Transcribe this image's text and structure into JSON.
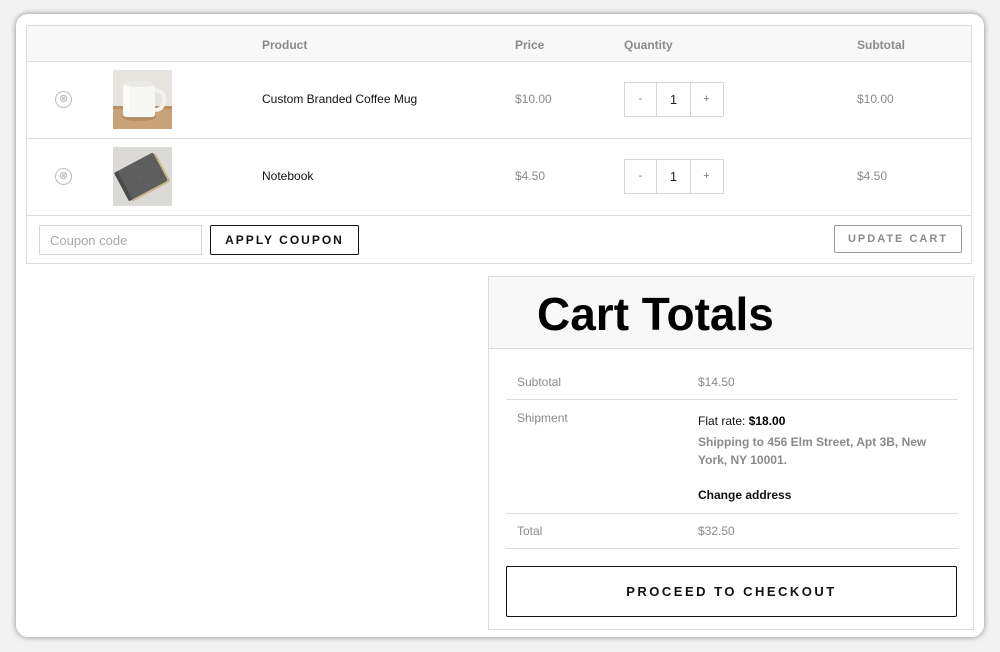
{
  "cart": {
    "headers": {
      "product": "Product",
      "price": "Price",
      "quantity": "Quantity",
      "subtotal": "Subtotal"
    },
    "items": [
      {
        "name": "Custom Branded Coffee Mug",
        "price": "$10.00",
        "quantity": "1",
        "subtotal": "$10.00",
        "image_icon": "coffee-mug-image"
      },
      {
        "name": "Notebook",
        "price": "$4.50",
        "quantity": "1",
        "subtotal": "$4.50",
        "image_icon": "notebook-image"
      }
    ],
    "qty_minus": "-",
    "qty_plus": "+",
    "remove_icon": "⊗",
    "coupon": {
      "placeholder": "Coupon code",
      "value": ""
    },
    "apply_coupon_label": "APPLY COUPON",
    "update_cart_label": "UPDATE CART"
  },
  "totals": {
    "title": "Cart Totals",
    "subtotal_label": "Subtotal",
    "subtotal_value": "$14.50",
    "shipment_label": "Shipment",
    "flat_rate_prefix": "Flat rate: ",
    "flat_rate_value": "$18.00",
    "shipping_to": "Shipping to 456 Elm Street, Apt 3B, New York, NY 10001.",
    "change_address_label": "Change address",
    "total_label": "Total",
    "total_value": "$32.50",
    "checkout_label": "PROCEED TO CHECKOUT"
  },
  "colors": {
    "header_bg": "#f8f8f8",
    "border": "#dcdcdc",
    "muted_text": "#8a8a8a",
    "primary_text": "#111111"
  }
}
